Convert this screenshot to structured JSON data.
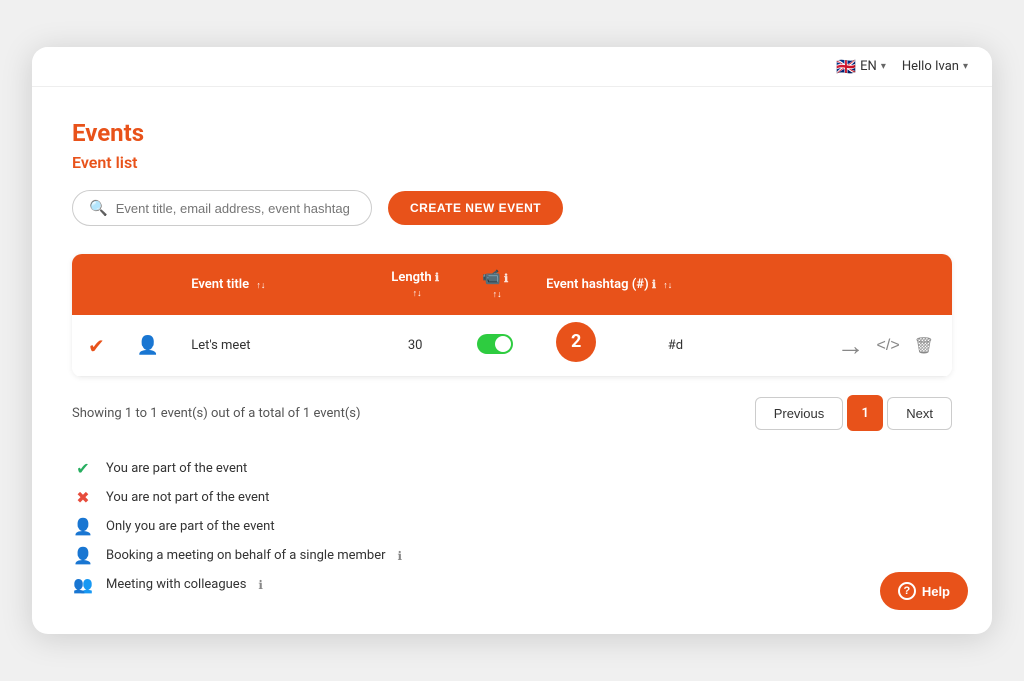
{
  "topbar": {
    "lang": "EN",
    "flag": "🇬🇧",
    "user_greeting": "Hello Ivan",
    "chevron": "▾"
  },
  "page": {
    "title": "Events",
    "section_title": "Event list"
  },
  "search": {
    "placeholder": "Event title, email address, event hashtag"
  },
  "toolbar": {
    "create_btn_label": "CREATE NEW EVENT"
  },
  "table": {
    "columns": [
      {
        "label": "",
        "key": "check"
      },
      {
        "label": "",
        "key": "person"
      },
      {
        "label": "Event title",
        "key": "title",
        "sortable": true
      },
      {
        "label": "Length",
        "key": "length",
        "info": true,
        "sortable": true
      },
      {
        "label": "",
        "key": "video",
        "info": true,
        "sortable": true
      },
      {
        "label": "Event hashtag (#)",
        "key": "hashtag",
        "info": true,
        "sortable": true
      },
      {
        "label": "",
        "key": "actions"
      }
    ],
    "rows": [
      {
        "check": "✔",
        "person": "👤",
        "title": "Let's meet",
        "length": "30",
        "video_enabled": true,
        "hashtag": "#d",
        "bubble_number": "2"
      }
    ]
  },
  "pagination": {
    "showing_text": "Showing 1 to 1 event(s) out of a total of 1 event(s)",
    "prev_label": "Previous",
    "next_label": "Next",
    "current_page": "1"
  },
  "legend": [
    {
      "icon_type": "check",
      "icon": "✔",
      "text": "You are part of the event"
    },
    {
      "icon_type": "cross",
      "icon": "✖",
      "text": "You are not part of the event"
    },
    {
      "icon_type": "person",
      "icon": "👤",
      "text": "Only you are part of the event"
    },
    {
      "icon_type": "person-ring",
      "icon": "👤",
      "text": "Booking a meeting on behalf of a single member",
      "info": true
    },
    {
      "icon_type": "persons",
      "icon": "👥",
      "text": "Meeting with colleagues",
      "info": true
    }
  ],
  "help": {
    "label": "Help",
    "icon": "?"
  }
}
